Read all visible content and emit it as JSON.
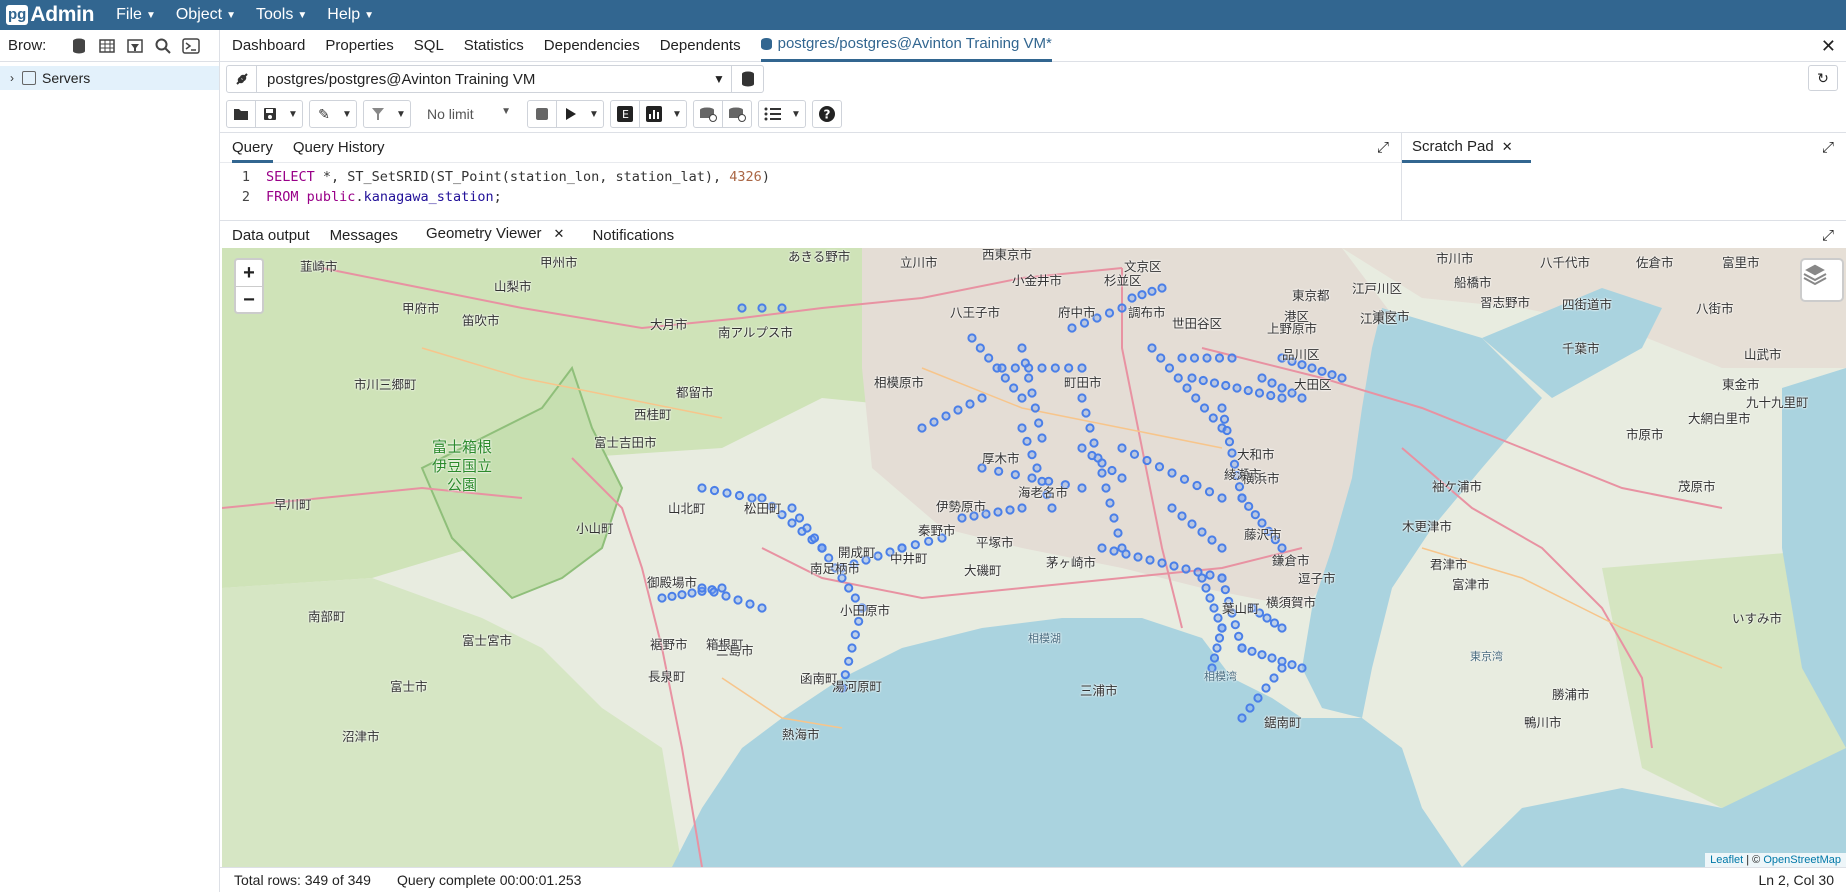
{
  "app": {
    "logo_pg": "pg",
    "logo_admin": "Admin"
  },
  "menu": [
    {
      "label": "File"
    },
    {
      "label": "Object"
    },
    {
      "label": "Tools"
    },
    {
      "label": "Help"
    }
  ],
  "browser": {
    "title": "Brow:",
    "tree": [
      {
        "label": "Servers"
      }
    ]
  },
  "main_tabs": [
    {
      "label": "Dashboard"
    },
    {
      "label": "Properties"
    },
    {
      "label": "SQL"
    },
    {
      "label": "Statistics"
    },
    {
      "label": "Dependencies"
    },
    {
      "label": "Dependents"
    },
    {
      "label": "postgres/postgres@Avinton Training VM*"
    }
  ],
  "connection": {
    "name": "postgres/postgres@Avinton Training VM"
  },
  "toolbar": {
    "limit": "No limit"
  },
  "editor": {
    "tabs": [
      "Query",
      "Query History"
    ],
    "scratch": "Scratch Pad",
    "lines": [
      {
        "num": "1",
        "kw1": "SELECT",
        "p1": " *, ST_SetSRID(ST_Point(station_lon, station_lat), ",
        "num_lit": "4326",
        "p2": ")"
      },
      {
        "num": "2",
        "kw1": "FROM",
        "schema": "public",
        "dot": ".",
        "table": "kanagawa_station",
        "end": ";"
      }
    ]
  },
  "result_tabs": [
    "Data output",
    "Messages",
    "Geometry Viewer",
    "Notifications"
  ],
  "map": {
    "zoom_in": "+",
    "zoom_out": "−",
    "attrib_leaflet": "Leaflet",
    "attrib_sep": " | © ",
    "attrib_osm": "OpenStreetMap",
    "park_label": [
      "富士箱根",
      "伊豆国立",
      "公園"
    ],
    "labels": [
      "韮崎市",
      "甲州市",
      "あきる野市",
      "立川市",
      "西東京市",
      "文京区",
      "市川市",
      "船橋市",
      "八千代市",
      "佐倉市",
      "富里市",
      "山梨市",
      "甲府市",
      "笛吹市",
      "大月市",
      "八王子市",
      "府中市",
      "調布市",
      "小金井市",
      "杉並区",
      "世田谷区",
      "東京都",
      "江戸川区",
      "習志野市",
      "四街道市",
      "八街市",
      "南アルプス市",
      "上野原市",
      "浦安市",
      "江東区",
      "港区",
      "千葉市",
      "品川区",
      "大田区",
      "山武市",
      "東金市",
      "市川三郷町",
      "都留市",
      "相模原市",
      "町田市",
      "大網白里市",
      "九十九里町",
      "西桂町",
      "市原市",
      "富士吉田市",
      "大和市",
      "厚木市",
      "綾瀬市",
      "海老名市",
      "横浜市",
      "袖ケ浦市",
      "茂原市",
      "早川町",
      "伊勢原市",
      "平塚市",
      "藤沢市",
      "秦野市",
      "木更津市",
      "南足柄市",
      "開成町",
      "中井町",
      "大磯町",
      "茅ヶ崎市",
      "鎌倉市",
      "逗子市",
      "君津市",
      "富津市",
      "御殿場市",
      "小田原市",
      "葉山町",
      "横須賀市",
      "いすみ市",
      "南部町",
      "富士宮市",
      "裾野市",
      "長泉町",
      "箱根町",
      "三島市",
      "函南町",
      "湯河原町",
      "三浦市",
      "鋸南町",
      "鴨川市",
      "勝浦市",
      "富士市",
      "沼津市",
      "熱海市",
      "山北町",
      "小山町",
      "松田町",
      "相模湖",
      "東京湾",
      "相模湾"
    ]
  },
  "status": {
    "rows": "Total rows: 349 of 349",
    "complete": "Query complete 00:00:01.253",
    "pos": "Ln 2, Col 30"
  },
  "colors": {
    "header": "#326690",
    "accent": "#326690",
    "marker": "#4a7fe8",
    "sea": "#aad3df"
  }
}
